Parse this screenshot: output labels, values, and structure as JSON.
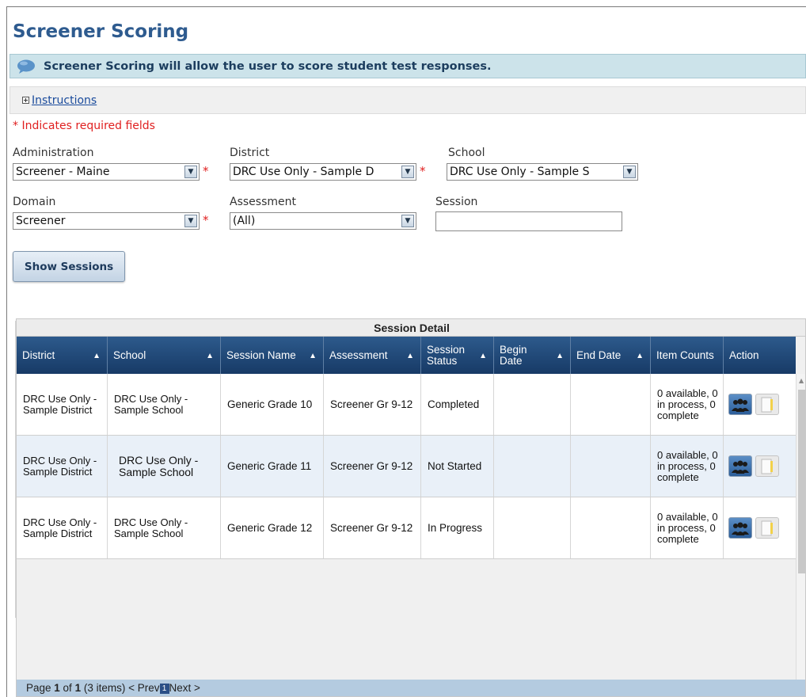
{
  "page": {
    "title": "Screener Scoring",
    "info_message": "Screener Scoring will allow the user to score student test responses.",
    "instructions_link": "Instructions",
    "required_note": "* Indicates required fields",
    "required_marker": "*"
  },
  "form": {
    "administration": {
      "label": "Administration",
      "value": "Screener - Maine"
    },
    "district": {
      "label": "District",
      "value": "DRC Use Only - Sample D"
    },
    "school": {
      "label": "School",
      "value": "DRC Use Only - Sample S"
    },
    "domain": {
      "label": "Domain",
      "value": "Screener"
    },
    "assessment": {
      "label": "Assessment",
      "value": "(All)"
    },
    "session": {
      "label": "Session",
      "value": ""
    },
    "show_sessions_button": "Show Sessions"
  },
  "grid": {
    "caption": "Session Detail",
    "columns": [
      "District",
      "School",
      "Session Name",
      "Assessment",
      "Session Status",
      "Begin Date",
      "End Date",
      "Item Counts",
      "Action"
    ],
    "rows": [
      {
        "district": "DRC Use Only - Sample District",
        "school": "DRC Use Only - Sample School",
        "session_name": "Generic Grade 10",
        "assessment": "Screener Gr 9-12",
        "status": "Completed",
        "begin_date": "",
        "end_date": "",
        "item_counts": "0 available, 0 in process, 0 complete"
      },
      {
        "district": "DRC Use Only - Sample District",
        "school": "DRC Use Only - Sample School",
        "session_name": "Generic Grade 11",
        "assessment": "Screener Gr 9-12",
        "status": "Not Started",
        "begin_date": "",
        "end_date": "",
        "item_counts": "0 available, 0 in process, 0 complete"
      },
      {
        "district": "DRC Use Only - Sample District",
        "school": "DRC Use Only - Sample School",
        "session_name": "Generic Grade 12",
        "assessment": "Screener Gr 9-12",
        "status": "In Progress",
        "begin_date": "",
        "end_date": "",
        "item_counts": "0 available, 0 in process, 0 complete"
      }
    ],
    "pager": {
      "prefix": "Page ",
      "current": "1",
      "of": " of ",
      "total": "1",
      "items": " (3 items) ",
      "prev": "< Prev",
      "page_num": "1",
      "next": "Next >"
    }
  },
  "colors": {
    "title": "#2e5b8f",
    "header_bg": "#1f4677",
    "required": "#e02020",
    "info_bar": "#cce3ea"
  },
  "icons": {
    "info": "speech-bubble-icon",
    "expand": "expand-plus-icon",
    "dropdown": "chevron-down-icon",
    "sort": "sort-ascending-icon",
    "score_students": "people-group-icon",
    "report": "document-pencil-icon"
  }
}
